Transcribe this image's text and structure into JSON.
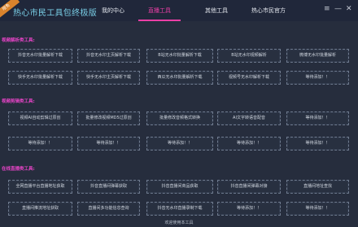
{
  "app": {
    "ribbon": "限免",
    "title": "热心市民工具包终极版"
  },
  "nav": {
    "tabs": [
      "我的中心",
      "直播工具",
      "其他工具",
      "热心市民官方"
    ],
    "active_index": 1,
    "controls": {
      "menu": "≡",
      "minimize": "—",
      "close": "✕"
    }
  },
  "colors": {
    "accent": "#ec3fa6",
    "section": "#ea44c9",
    "title": "#7ad0e8",
    "badge": "#d9832c"
  },
  "sections": [
    {
      "label": "视频解析类工具:",
      "rows": [
        [
          "抖音无水印批量解析下载",
          "抖音无水印主页解析下载",
          "B站无水印批量解析下载",
          "B站无水印视频解析",
          "微博无水印批量解析"
        ],
        [
          "快手无水印批量解析下载",
          "快手无水印主页解析下载",
          "西瓜无水印批量解析下载",
          "视频号无水印解析下载",
          "等待添加！！"
        ]
      ]
    },
    {
      "label": "视频剪辑类工具:",
      "rows": [
        [
          "视频AI自动剪辑过原创",
          "批量修改视频MD5过原创",
          "批量修改音频格式转换",
          "AI文字转语音配音",
          "等待添加！！"
        ],
        [
          "等待添加！！",
          "等待添加！！",
          "等待添加！！",
          "等待添加！！",
          "等待添加！！"
        ]
      ]
    },
    {
      "label": "在线直播类工具:",
      "rows": [
        [
          "全网直播平台直播地址获取",
          "抖音直播间弹幕获取",
          "抖音直播间商品获取",
          "抖音直播间弹幕对接",
          "直播间地址查找"
        ],
        [
          "直播间推流地址获取",
          "直播间多功能信息查询",
          "抖音无水印直播录制下载",
          "等待添加！！",
          "等待添加！！"
        ]
      ]
    }
  ],
  "status": "欢迎使用本工具"
}
